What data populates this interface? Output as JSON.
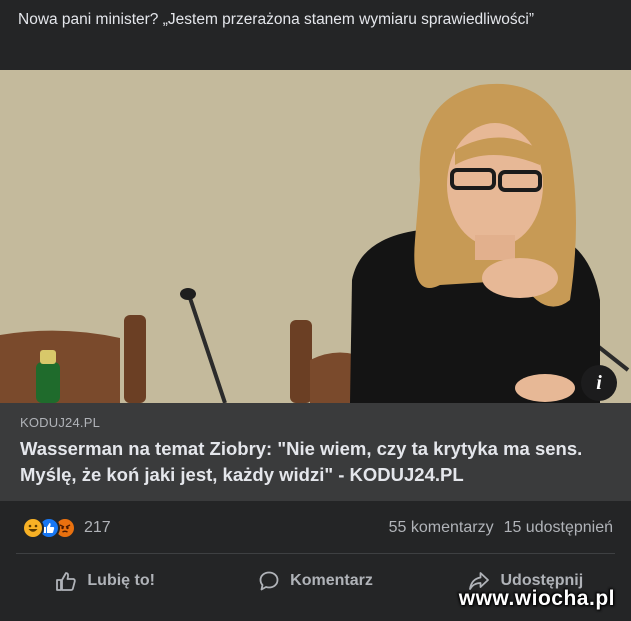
{
  "post": {
    "text": "Nowa pani minister? „Jestem przerażona stanem wymiaru sprawiedliwości”"
  },
  "link": {
    "domain": "KODUJ24.PL",
    "title": "Wasserman na temat Ziobry: \"Nie wiem, czy ta krytyka ma sens. Myślę, że koń jaki jest, każdy widzi\" - KODUJ24.PL",
    "info_glyph": "i"
  },
  "stats": {
    "reactions": [
      "haha",
      "like",
      "angry"
    ],
    "reaction_count": "217",
    "comments": "55 komentarzy",
    "shares": "15 udostępnień"
  },
  "actions": {
    "like_label": "Lubię to!",
    "comment_label": "Komentarz",
    "share_label": "Udostępnij"
  },
  "watermark": {
    "text": "www.wiocha.pl"
  },
  "colors": {
    "background": "#242526",
    "link_box": "#3a3b3c",
    "primary_text": "#e4e6eb",
    "secondary_text": "#b0b3b8",
    "like_blue": "#1877f2",
    "haha_yellow": "#f7b125",
    "angry_orange": "#e9710f"
  }
}
